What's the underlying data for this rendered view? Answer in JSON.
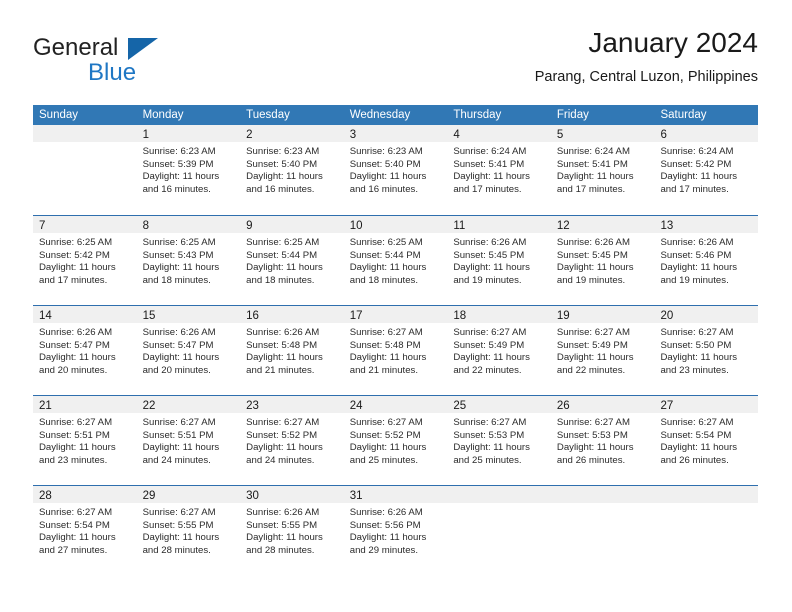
{
  "brand": {
    "name_top": "General",
    "name_bottom": "Blue",
    "accent_color": "#1f77c4",
    "triangle_color": "#1565a8"
  },
  "header": {
    "title": "January 2024",
    "subtitle": "Parang, Central Luzon, Philippines"
  },
  "theme": {
    "header_bg": "#3178b5",
    "row_divider": "#2f6fae",
    "day_band_bg": "#f0f0f0",
    "page_bg": "#ffffff"
  },
  "weekdays": [
    "Sunday",
    "Monday",
    "Tuesday",
    "Wednesday",
    "Thursday",
    "Friday",
    "Saturday"
  ],
  "weeks": [
    [
      {
        "day": "",
        "sunrise": "",
        "sunset": "",
        "daylight_1": "",
        "daylight_2": ""
      },
      {
        "day": "1",
        "sunrise": "Sunrise: 6:23 AM",
        "sunset": "Sunset: 5:39 PM",
        "daylight_1": "Daylight: 11 hours",
        "daylight_2": "and 16 minutes."
      },
      {
        "day": "2",
        "sunrise": "Sunrise: 6:23 AM",
        "sunset": "Sunset: 5:40 PM",
        "daylight_1": "Daylight: 11 hours",
        "daylight_2": "and 16 minutes."
      },
      {
        "day": "3",
        "sunrise": "Sunrise: 6:23 AM",
        "sunset": "Sunset: 5:40 PM",
        "daylight_1": "Daylight: 11 hours",
        "daylight_2": "and 16 minutes."
      },
      {
        "day": "4",
        "sunrise": "Sunrise: 6:24 AM",
        "sunset": "Sunset: 5:41 PM",
        "daylight_1": "Daylight: 11 hours",
        "daylight_2": "and 17 minutes."
      },
      {
        "day": "5",
        "sunrise": "Sunrise: 6:24 AM",
        "sunset": "Sunset: 5:41 PM",
        "daylight_1": "Daylight: 11 hours",
        "daylight_2": "and 17 minutes."
      },
      {
        "day": "6",
        "sunrise": "Sunrise: 6:24 AM",
        "sunset": "Sunset: 5:42 PM",
        "daylight_1": "Daylight: 11 hours",
        "daylight_2": "and 17 minutes."
      }
    ],
    [
      {
        "day": "7",
        "sunrise": "Sunrise: 6:25 AM",
        "sunset": "Sunset: 5:42 PM",
        "daylight_1": "Daylight: 11 hours",
        "daylight_2": "and 17 minutes."
      },
      {
        "day": "8",
        "sunrise": "Sunrise: 6:25 AM",
        "sunset": "Sunset: 5:43 PM",
        "daylight_1": "Daylight: 11 hours",
        "daylight_2": "and 18 minutes."
      },
      {
        "day": "9",
        "sunrise": "Sunrise: 6:25 AM",
        "sunset": "Sunset: 5:44 PM",
        "daylight_1": "Daylight: 11 hours",
        "daylight_2": "and 18 minutes."
      },
      {
        "day": "10",
        "sunrise": "Sunrise: 6:25 AM",
        "sunset": "Sunset: 5:44 PM",
        "daylight_1": "Daylight: 11 hours",
        "daylight_2": "and 18 minutes."
      },
      {
        "day": "11",
        "sunrise": "Sunrise: 6:26 AM",
        "sunset": "Sunset: 5:45 PM",
        "daylight_1": "Daylight: 11 hours",
        "daylight_2": "and 19 minutes."
      },
      {
        "day": "12",
        "sunrise": "Sunrise: 6:26 AM",
        "sunset": "Sunset: 5:45 PM",
        "daylight_1": "Daylight: 11 hours",
        "daylight_2": "and 19 minutes."
      },
      {
        "day": "13",
        "sunrise": "Sunrise: 6:26 AM",
        "sunset": "Sunset: 5:46 PM",
        "daylight_1": "Daylight: 11 hours",
        "daylight_2": "and 19 minutes."
      }
    ],
    [
      {
        "day": "14",
        "sunrise": "Sunrise: 6:26 AM",
        "sunset": "Sunset: 5:47 PM",
        "daylight_1": "Daylight: 11 hours",
        "daylight_2": "and 20 minutes."
      },
      {
        "day": "15",
        "sunrise": "Sunrise: 6:26 AM",
        "sunset": "Sunset: 5:47 PM",
        "daylight_1": "Daylight: 11 hours",
        "daylight_2": "and 20 minutes."
      },
      {
        "day": "16",
        "sunrise": "Sunrise: 6:26 AM",
        "sunset": "Sunset: 5:48 PM",
        "daylight_1": "Daylight: 11 hours",
        "daylight_2": "and 21 minutes."
      },
      {
        "day": "17",
        "sunrise": "Sunrise: 6:27 AM",
        "sunset": "Sunset: 5:48 PM",
        "daylight_1": "Daylight: 11 hours",
        "daylight_2": "and 21 minutes."
      },
      {
        "day": "18",
        "sunrise": "Sunrise: 6:27 AM",
        "sunset": "Sunset: 5:49 PM",
        "daylight_1": "Daylight: 11 hours",
        "daylight_2": "and 22 minutes."
      },
      {
        "day": "19",
        "sunrise": "Sunrise: 6:27 AM",
        "sunset": "Sunset: 5:49 PM",
        "daylight_1": "Daylight: 11 hours",
        "daylight_2": "and 22 minutes."
      },
      {
        "day": "20",
        "sunrise": "Sunrise: 6:27 AM",
        "sunset": "Sunset: 5:50 PM",
        "daylight_1": "Daylight: 11 hours",
        "daylight_2": "and 23 minutes."
      }
    ],
    [
      {
        "day": "21",
        "sunrise": "Sunrise: 6:27 AM",
        "sunset": "Sunset: 5:51 PM",
        "daylight_1": "Daylight: 11 hours",
        "daylight_2": "and 23 minutes."
      },
      {
        "day": "22",
        "sunrise": "Sunrise: 6:27 AM",
        "sunset": "Sunset: 5:51 PM",
        "daylight_1": "Daylight: 11 hours",
        "daylight_2": "and 24 minutes."
      },
      {
        "day": "23",
        "sunrise": "Sunrise: 6:27 AM",
        "sunset": "Sunset: 5:52 PM",
        "daylight_1": "Daylight: 11 hours",
        "daylight_2": "and 24 minutes."
      },
      {
        "day": "24",
        "sunrise": "Sunrise: 6:27 AM",
        "sunset": "Sunset: 5:52 PM",
        "daylight_1": "Daylight: 11 hours",
        "daylight_2": "and 25 minutes."
      },
      {
        "day": "25",
        "sunrise": "Sunrise: 6:27 AM",
        "sunset": "Sunset: 5:53 PM",
        "daylight_1": "Daylight: 11 hours",
        "daylight_2": "and 25 minutes."
      },
      {
        "day": "26",
        "sunrise": "Sunrise: 6:27 AM",
        "sunset": "Sunset: 5:53 PM",
        "daylight_1": "Daylight: 11 hours",
        "daylight_2": "and 26 minutes."
      },
      {
        "day": "27",
        "sunrise": "Sunrise: 6:27 AM",
        "sunset": "Sunset: 5:54 PM",
        "daylight_1": "Daylight: 11 hours",
        "daylight_2": "and 26 minutes."
      }
    ],
    [
      {
        "day": "28",
        "sunrise": "Sunrise: 6:27 AM",
        "sunset": "Sunset: 5:54 PM",
        "daylight_1": "Daylight: 11 hours",
        "daylight_2": "and 27 minutes."
      },
      {
        "day": "29",
        "sunrise": "Sunrise: 6:27 AM",
        "sunset": "Sunset: 5:55 PM",
        "daylight_1": "Daylight: 11 hours",
        "daylight_2": "and 28 minutes."
      },
      {
        "day": "30",
        "sunrise": "Sunrise: 6:26 AM",
        "sunset": "Sunset: 5:55 PM",
        "daylight_1": "Daylight: 11 hours",
        "daylight_2": "and 28 minutes."
      },
      {
        "day": "31",
        "sunrise": "Sunrise: 6:26 AM",
        "sunset": "Sunset: 5:56 PM",
        "daylight_1": "Daylight: 11 hours",
        "daylight_2": "and 29 minutes."
      },
      {
        "day": "",
        "sunrise": "",
        "sunset": "",
        "daylight_1": "",
        "daylight_2": ""
      },
      {
        "day": "",
        "sunrise": "",
        "sunset": "",
        "daylight_1": "",
        "daylight_2": ""
      },
      {
        "day": "",
        "sunrise": "",
        "sunset": "",
        "daylight_1": "",
        "daylight_2": ""
      }
    ]
  ]
}
